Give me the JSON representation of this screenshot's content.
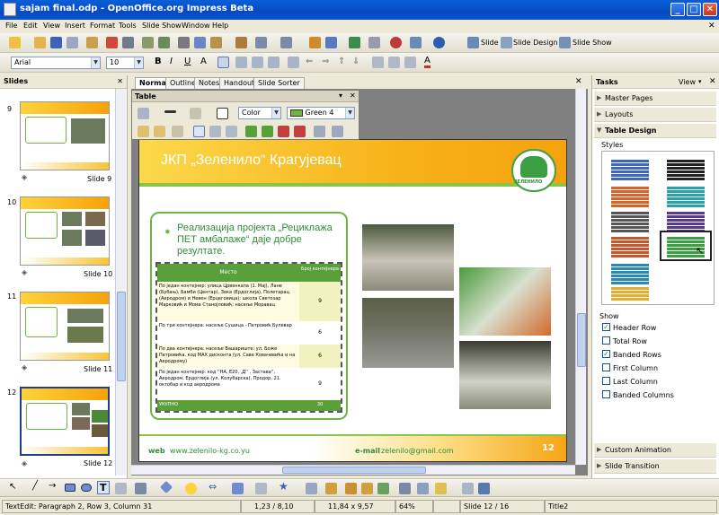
{
  "window": {
    "title": "sajam final.odp - OpenOffice.org Impress Beta"
  },
  "menu": [
    "File",
    "Edit",
    "View",
    "Insert",
    "Format",
    "Tools",
    "Slide Show",
    "Window",
    "Help"
  ],
  "toolbar": {
    "slide_label": "Slide",
    "slide_design_label": "Slide Design",
    "slide_show_label": "Slide Show"
  },
  "format_bar": {
    "font": "Arial",
    "size": "10"
  },
  "slides_pane": {
    "title": "Slides",
    "items": [
      {
        "label": "Slide 9"
      },
      {
        "label": "Slide 10"
      },
      {
        "label": "Slide 11"
      },
      {
        "label": "Slide 12"
      }
    ]
  },
  "view_tabs": [
    "Normal",
    "Outline",
    "Notes",
    "Handout",
    "Slide Sorter"
  ],
  "table_panel": {
    "title": "Table",
    "border_type": "Color",
    "border_color": "Green 4"
  },
  "slide": {
    "header": "ЈКП „Зеленило“ Крагујевац",
    "logo_text": "ЗЕЛЕНИЛО",
    "bullet": "Реализација пројекта „Рециклажа ПЕТ амбалаже“ даје добре резултате.",
    "table": {
      "headers": [
        "Место",
        "Број контејнера"
      ],
      "rows": [
        {
          "place": "По један контејнер: улица Црвенкапа (1. Мај), Лане (Бубањ), Бамби (Центар), Зека (Ердоглија), Полетарац (Аеродром) и Невен (Ерцеговица); школа Светозар Марковић и Мома Станојловић; насеље Моравац",
          "count": "9"
        },
        {
          "place": "По три контејнера: насеље Сушица - Петровић Булевар",
          "count": "6"
        },
        {
          "place": "По два контејнера: насеље Вашариште: ул. Боже Петровића, код МАХ дисконта (ул. Саве Ковачевића и на Аеродрому)",
          "count": "6"
        },
        {
          "place": "По један контејнер: код ''НА, E20, ,Д'' , Застава'', Аеродром, Ердоглија (ул. Колубарска), Продор, 21. октобар и код аеродрома",
          "count": "9"
        },
        {
          "place": "УКУПНО",
          "count": "30"
        }
      ]
    },
    "web_label": "web",
    "web": "www.zelenilo-kg.co.yu",
    "email_label": "e-mail",
    "email": "zelenilo@gmail.com",
    "page": "12"
  },
  "tasks": {
    "title": "Tasks",
    "view_label": "View",
    "sections": [
      "Master Pages",
      "Layouts",
      "Table Design"
    ],
    "styles_label": "Styles",
    "show_label": "Show",
    "options": [
      {
        "label": "Header Row",
        "checked": true
      },
      {
        "label": "Total Row",
        "checked": false
      },
      {
        "label": "Banded Rows",
        "checked": true
      },
      {
        "label": "First Column",
        "checked": false
      },
      {
        "label": "Last Column",
        "checked": false
      },
      {
        "label": "Banded Columns",
        "checked": false
      }
    ],
    "bottom": [
      "Custom Animation",
      "Slide Transition"
    ]
  },
  "status": {
    "mode": "TextEdit: Paragraph 2, Row 3, Column 31",
    "pos": "1,23 / 8,10",
    "size": "11,84 x 9,57",
    "zoom": "64%",
    "slide": "Slide 12 / 16",
    "layout": "Title2"
  }
}
